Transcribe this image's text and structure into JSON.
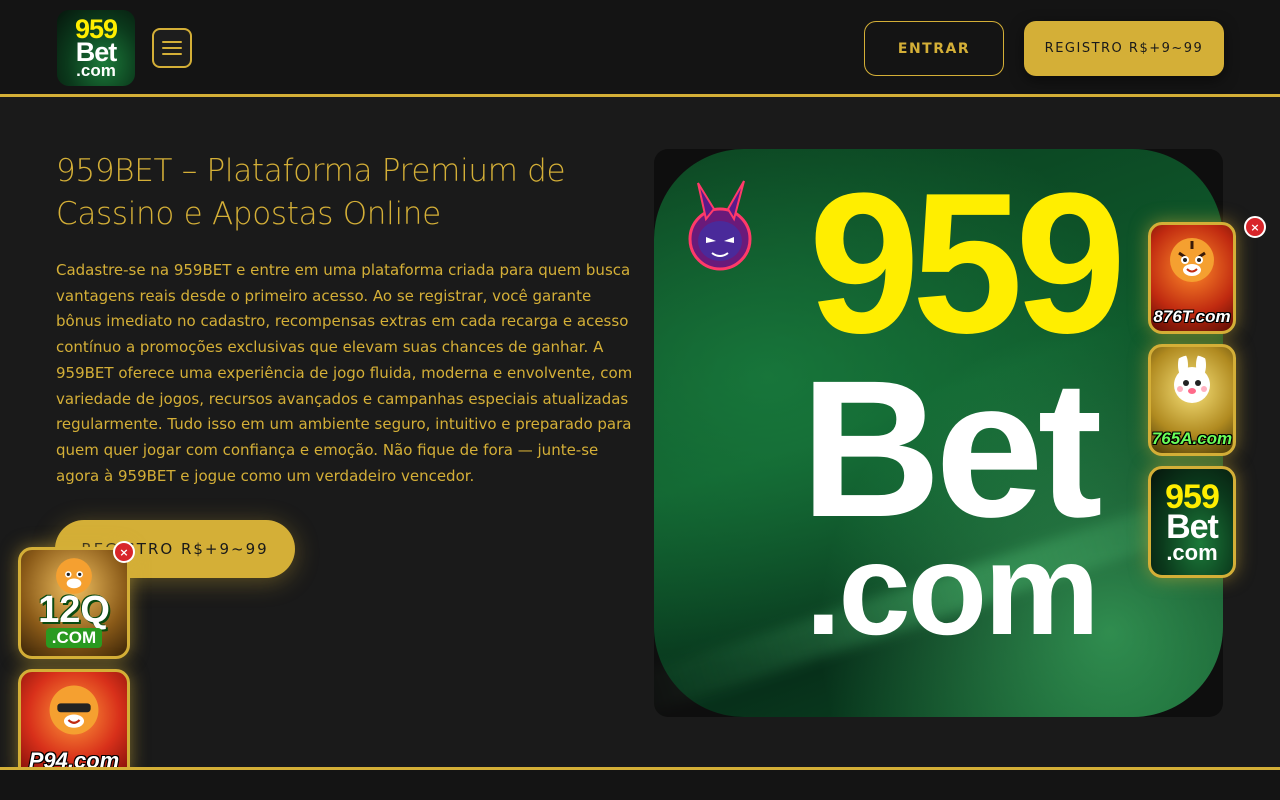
{
  "header": {
    "logo": {
      "line1": "959",
      "line2": "Bet",
      "line3": ".com"
    },
    "login_label": "ENTRAR",
    "register_label": "REGISTRO R$+9~99"
  },
  "hero": {
    "title": "959BET – Plataforma Premium de Cassino e Apostas Online",
    "description": "Cadastre-se na 959BET e entre em uma plataforma criada para quem busca vantagens reais desde o primeiro acesso. Ao se registrar, você garante bônus imediato no cadastro, recompensas extras em cada recarga e acesso contínuo a promoções exclusivas que elevam suas chances de ganhar. A 959BET oferece uma experiência de jogo fluida, moderna e envolvente, com variedade de jogos, recursos avançados e campanhas especiais atualizadas regularmente. Tudo isso em um ambiente seguro, intuitivo e preparado para quem quer jogar com confiança e emoção. Não fique de fora — junte-se agora à 959BET e jogue como um verdadeiro vencedor.",
    "cta_label": "REGISTRO R$+9~99",
    "image": {
      "line1": "959",
      "line2": "Bet",
      "line3": ".com"
    }
  },
  "floating_ads": {
    "right": [
      {
        "label": "876T.com",
        "icon": "tiger-mascot-icon"
      },
      {
        "label": "765A.com",
        "icon": "rabbit-mascot-icon"
      },
      {
        "line1": "959",
        "line2": "Bet",
        "line3": ".com"
      }
    ],
    "left": [
      {
        "line1": "12Q",
        "line2": ".COM",
        "icon": "tiger-mascot-icon"
      },
      {
        "label": "P94.com",
        "icon": "tiger-mascot-icon"
      }
    ],
    "close_symbol": "×"
  },
  "colors": {
    "accent": "#d4af37",
    "background": "#1a1a1a",
    "header_bg": "#141414",
    "logo_yellow": "#ffee00",
    "close_red": "#d8252a"
  }
}
